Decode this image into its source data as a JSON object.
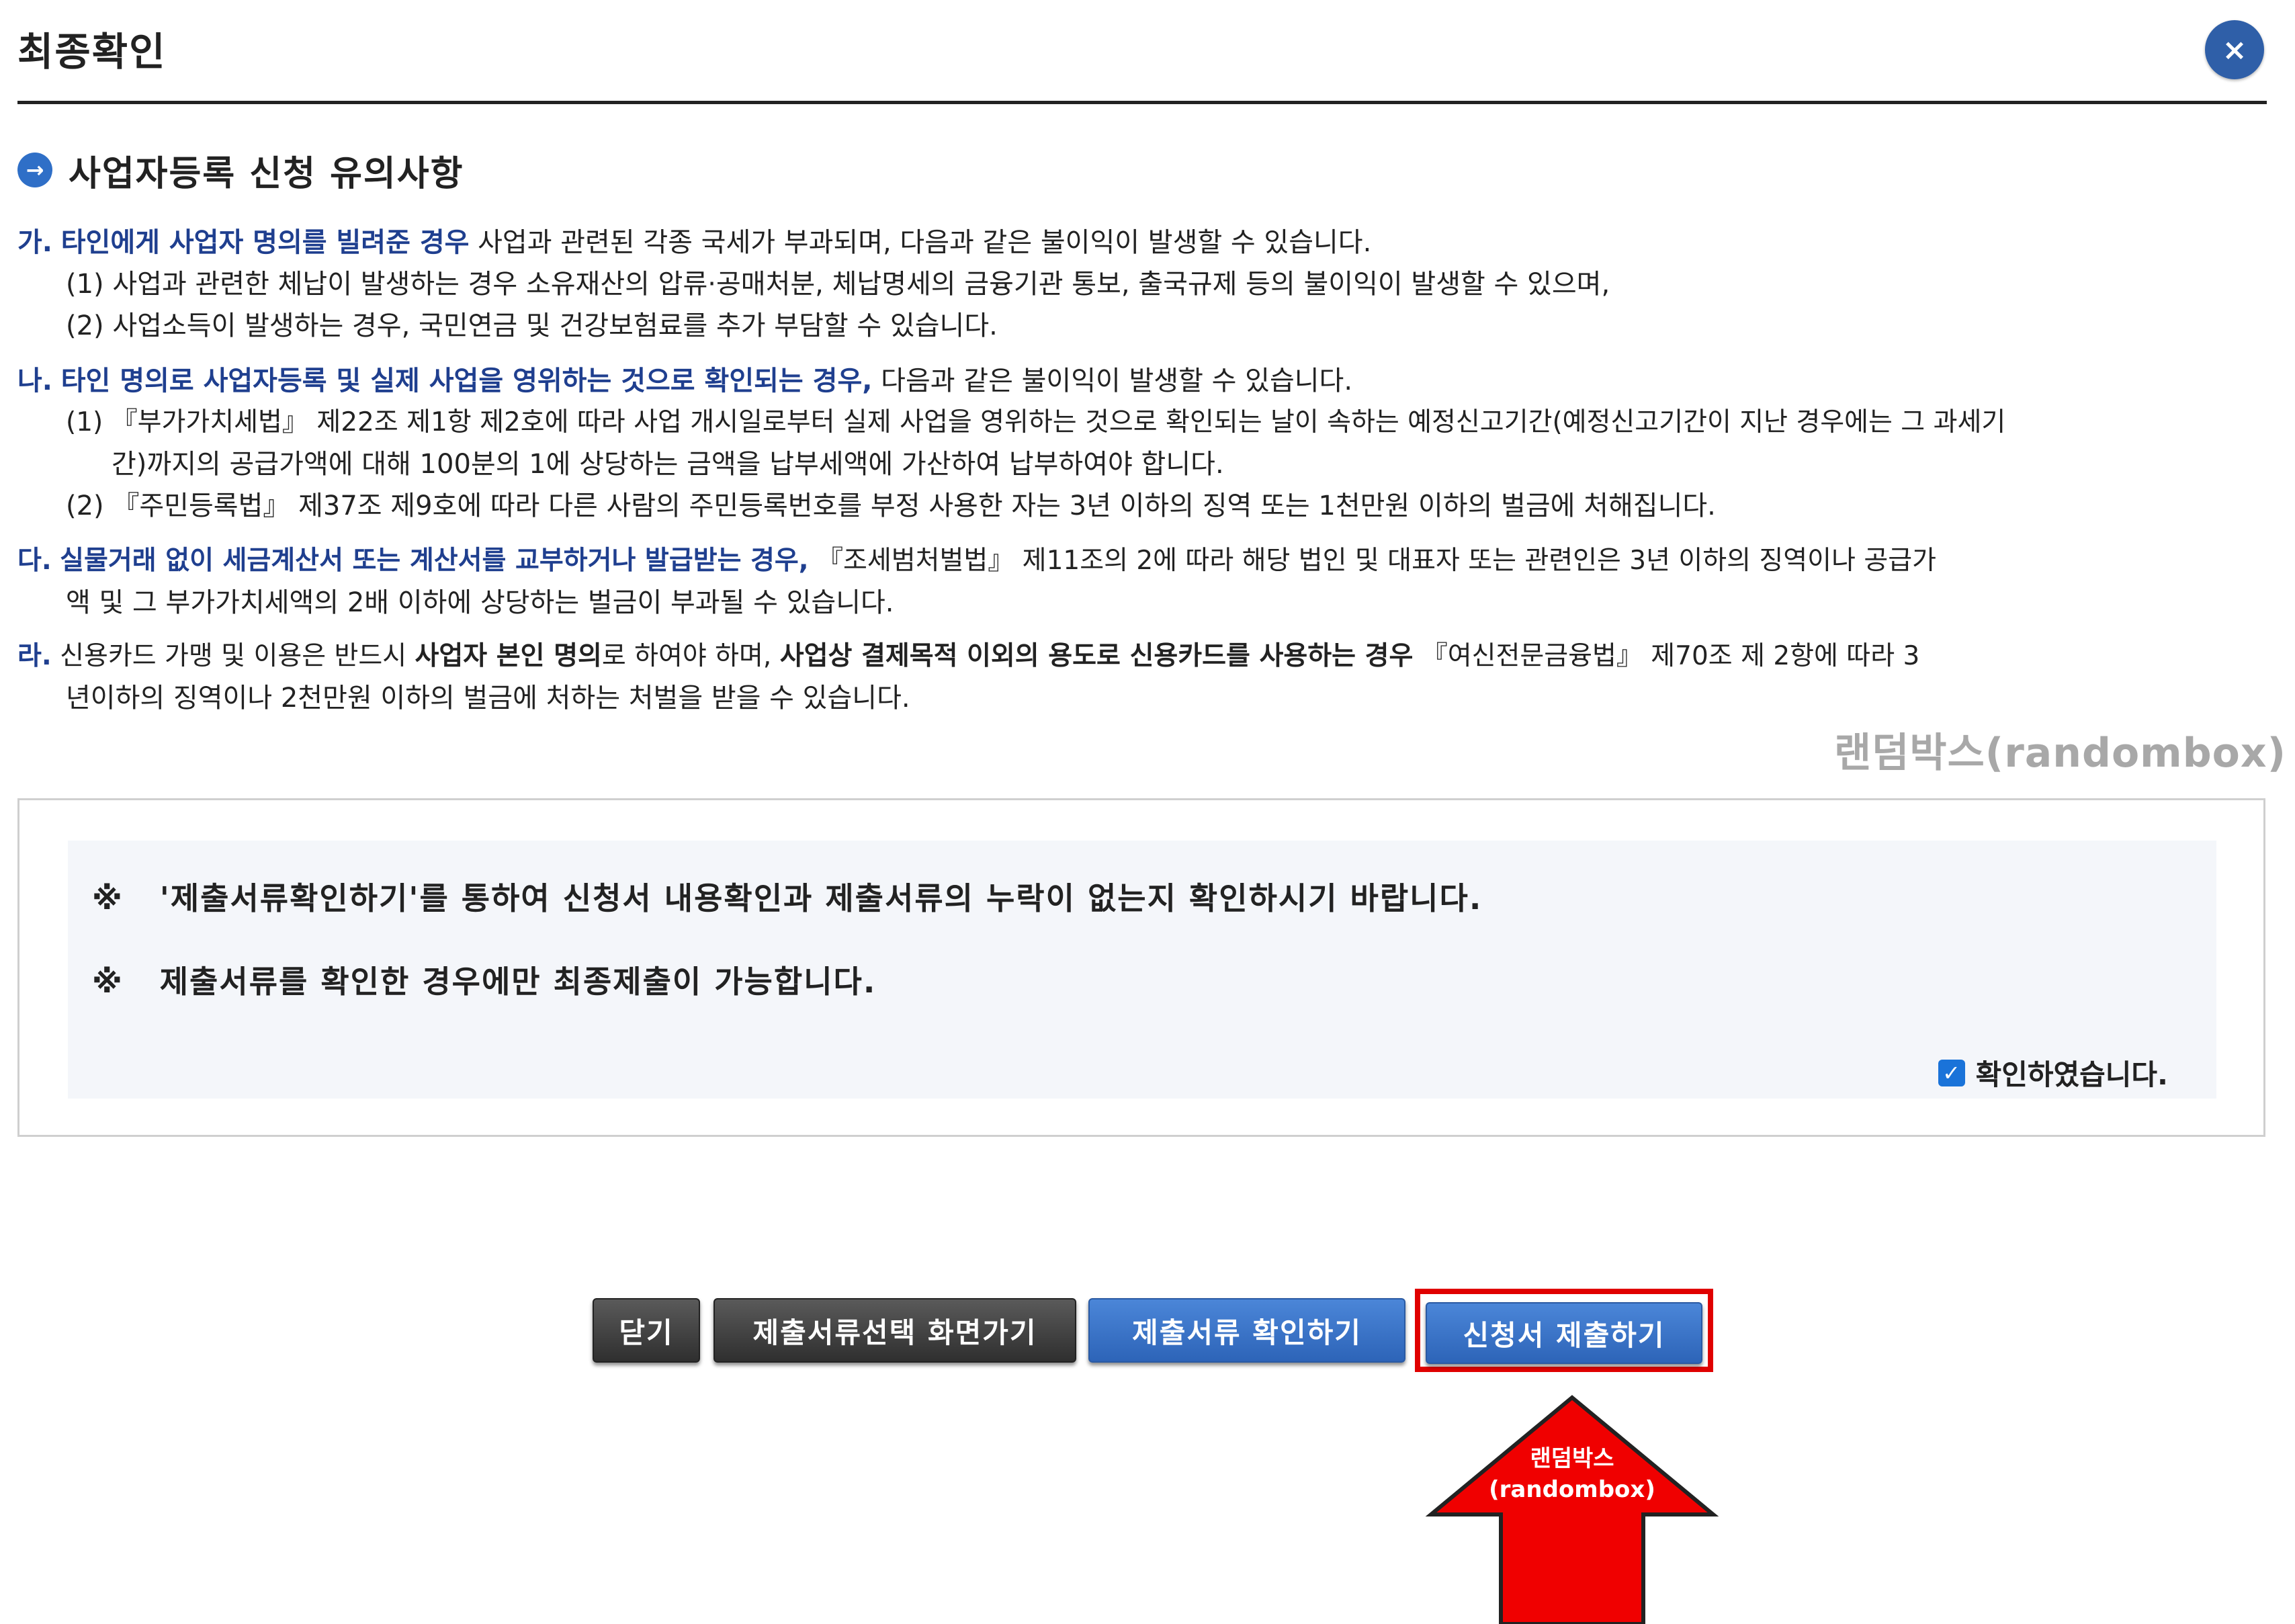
{
  "dialog": {
    "title": "최종확인",
    "close_label": "×"
  },
  "section": {
    "title": "사업자등록 신청 유의사항"
  },
  "notices": {
    "ga": {
      "marker": "가.",
      "emph": "타인에게 사업자 명의를 빌려준 경우",
      "text": " 사업과 관련된 각종 국세가 부과되며, 다음과 같은 불이익이 발생할 수 있습니다.",
      "sub1": "(1) 사업과 관련한 체납이 발생하는 경우 소유재산의 압류·공매처분, 체납명세의 금융기관 통보, 출국규제 등의 불이익이 발생할 수 있으며,",
      "sub2": "(2) 사업소득이 발생하는 경우, 국민연금 및 건강보험료를 추가 부담할 수 있습니다."
    },
    "na": {
      "marker": "나.",
      "emph": "타인 명의로 사업자등록 및 실제 사업을 영위하는 것으로 확인되는 경우,",
      "text": " 다음과 같은 불이익이 발생할 수 있습니다.",
      "sub1a": "(1) 『부가가치세법』 제22조 제1항 제2호에 따라 사업 개시일로부터 실제 사업을 영위하는 것으로 확인되는 날이 속하는 예정신고기간(예정신고기간이 지난 경우에는 그 과세기",
      "sub1b": "간)까지의 공급가액에 대해 100분의 1에 상당하는 금액을 납부세액에 가산하여 납부하여야 합니다.",
      "sub2": "(2) 『주민등록법』 제37조 제9호에 따라 다른 사람의 주민등록번호를 부정 사용한 자는 3년 이하의 징역 또는 1천만원 이하의 벌금에 처해집니다."
    },
    "da": {
      "marker": "다.",
      "emph": "실물거래 없이 세금계산서 또는 계산서를 교부하거나 발급받는 경우,",
      "text_a": " 『조세범처벌법』 제11조의 2에 따라 해당 법인 및 대표자 또는 관련인은 3년 이하의 징역이나 공급가",
      "text_b": "액 및 그 부가가치세액의 2배 이하에 상당하는 벌금이 부과될 수 있습니다."
    },
    "ra": {
      "marker": "라.",
      "text1": " 신용카드 가맹 및 이용은 반드시 ",
      "bold1": "사업자 본인 명의",
      "text2": "로 하여야 하며, ",
      "bold2": "사업상 결제목적 이외의 용도로 신용카드를 사용하는 경우",
      "text3": " 『여신전문금융법』 제70조 제 2항에 따라 3",
      "text4": "년이하의 징역이나 2천만원 이하의 벌금에 처하는 처벌을 받을 수 있습니다."
    }
  },
  "watermark": "랜덤박스(randombox)",
  "confirm": {
    "ref_mark": "※",
    "line1": "'제출서류확인하기'를 통하여 신청서 내용확인과 제출서류의 누락이 없는지 확인하시기 바랍니다.",
    "line2": "제출서류를 확인한 경우에만 최종제출이 가능합니다.",
    "checkbox_label": "확인하였습니다.",
    "checked": true
  },
  "buttons": {
    "close": "닫기",
    "select_docs": "제출서류선택 화면가기",
    "check_docs": "제출서류 확인하기",
    "submit": "신청서 제출하기"
  },
  "arrow_label": {
    "line1": "랜덤박스",
    "line2": "(randombox)"
  },
  "colors": {
    "accent_blue": "#2f5fa8",
    "highlight_red": "#e00000"
  }
}
